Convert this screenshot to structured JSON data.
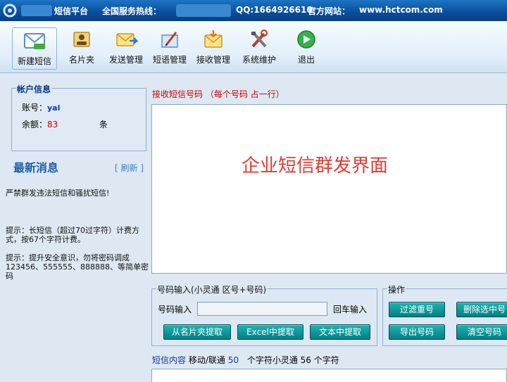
{
  "titlebar": {
    "platform": "短信平台",
    "hotline_label": "全国服务热线：",
    "qq": "QQ:1664926610",
    "site_label": "官方网站：",
    "site": "www.hctcom.com"
  },
  "toolbar": {
    "items": [
      {
        "label": "新建短信",
        "icon": "new-message-icon"
      },
      {
        "label": "名片夹",
        "icon": "contacts-icon"
      },
      {
        "label": "发送管理",
        "icon": "send-manage-icon"
      },
      {
        "label": "短语管理",
        "icon": "phrase-manage-icon"
      },
      {
        "label": "接收管理",
        "icon": "receive-manage-icon"
      },
      {
        "label": "系统维护",
        "icon": "system-maintenance-icon"
      },
      {
        "label": "退出",
        "icon": "exit-icon"
      }
    ]
  },
  "account": {
    "title": "帐户信息",
    "user_label": "账号：",
    "user": "yal",
    "balance_label": "余额：",
    "balance": "83",
    "unit": "条"
  },
  "news": {
    "title": "最新消息",
    "refresh": "[ 刷新 ]",
    "warning": "严禁群发违法短信和骚扰短信!",
    "tip1": "提示：长短信（超过70过字符）计费方式，按67个字符计费。",
    "tip2": "提示：提升安全意识，勿将密码调成123456、555555、888888、等简单密码"
  },
  "receiver": {
    "label": "接收短信号码 （每个号码 占一行）",
    "watermark": "企业短信群发界面"
  },
  "number_input": {
    "group_title": "号码输入(小灵通 区号+号码)",
    "field_label": "号码输入",
    "field_value": "",
    "enter_hint": "回车输入",
    "btn_from_cards": "从名片夹提取",
    "btn_from_excel": "Excel中提取",
    "btn_from_text": "文本中提取"
  },
  "operations": {
    "group_title": "操作",
    "btn_filter_dup": "过滤重号",
    "btn_delete_selected": "删除选中号",
    "btn_export": "导出号码",
    "btn_clear": "清空号码"
  },
  "message": {
    "label": "短信内容",
    "carrier": "移动/联通",
    "count": "50",
    "suffix": "个字符小灵通 56 个字符"
  },
  "colors": {
    "accent_red": "#e8392f",
    "button_teal": "#037f82",
    "title_blue": "#0a4d9a"
  }
}
